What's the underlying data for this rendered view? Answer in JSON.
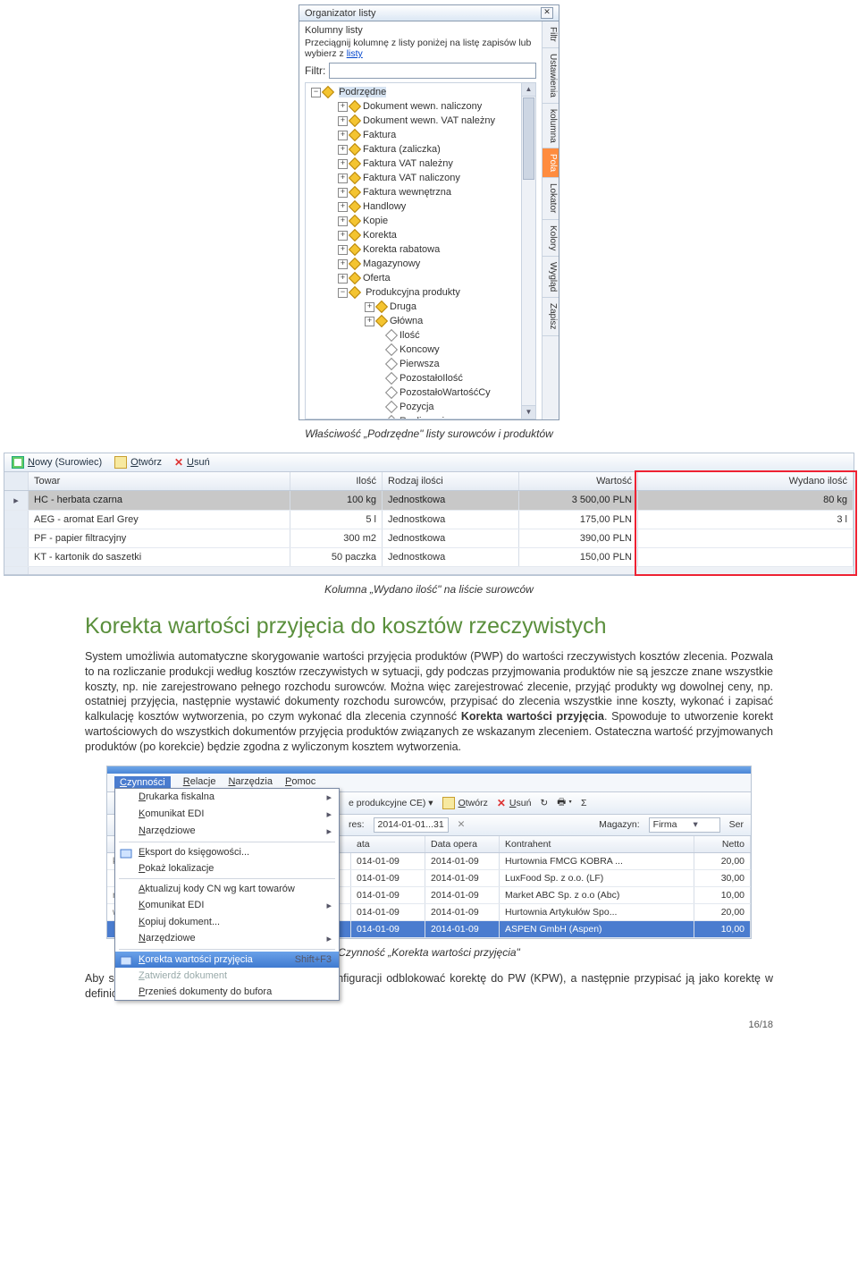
{
  "organizer": {
    "title": "Organizator listy",
    "section_label": "Kolumny listy",
    "hint_pre": "Przeciągnij kolumnę z listy poniżej na listę zapisów lub wybierz z ",
    "hint_link": "listy",
    "filtr_label": "Filtr:",
    "filtr_value": "",
    "tree": {
      "root": "Podrzędne",
      "items": [
        "Dokument wewn. naliczony",
        "Dokument wewn. VAT należny",
        "Faktura",
        "Faktura (zaliczka)",
        "Faktura VAT należny",
        "Faktura VAT naliczony",
        "Faktura wewnętrzna",
        "Handlowy",
        "Kopie",
        "Korekta",
        "Korekta rabatowa",
        "Magazynowy",
        "Oferta"
      ],
      "prod_root": "Produkcyjna produkty",
      "prod_items": [
        "Druga",
        "Główna",
        "Ilość",
        "Koncowy",
        "Pierwsza",
        "PozostałoIlość",
        "PozostałoWartośćCy",
        "Pozycja",
        "Rozliczanie"
      ]
    },
    "side_tabs": [
      "Filtr",
      "Ustawienia",
      "kolumna",
      "Pola",
      "Lokator",
      "Kolory",
      "Wygląd",
      "Zapisz"
    ],
    "side_active": 3
  },
  "caption1": "Właściwość „Podrzędne\" listy surowców i produktów",
  "grid": {
    "buttons": {
      "new": "Nowy (Surowiec)",
      "open": "Otwórz",
      "del": "Usuń"
    },
    "cols": [
      "Towar",
      "Ilość",
      "Rodzaj ilości",
      "Wartość",
      "Wydano ilość"
    ],
    "rows": [
      {
        "towar": "HC - herbata czarna",
        "il": "100 kg",
        "rodz": "Jednostkowa",
        "wart": "3 500,00 PLN",
        "wyd": "80 kg",
        "sel": true
      },
      {
        "towar": "AEG - aromat Earl Grey",
        "il": "5 l",
        "rodz": "Jednostkowa",
        "wart": "175,00 PLN",
        "wyd": "3 l"
      },
      {
        "towar": "PF - papier filtracyjny",
        "il": "300 m2",
        "rodz": "Jednostkowa",
        "wart": "390,00 PLN",
        "wyd": ""
      },
      {
        "towar": "KT - kartonik do saszetki",
        "il": "50 paczka",
        "rodz": "Jednostkowa",
        "wart": "150,00 PLN",
        "wyd": ""
      }
    ]
  },
  "caption2": "Kolumna „Wydano ilość\" na liście surowców",
  "section_title": "Korekta wartości przyjęcia do kosztów rzeczywistych",
  "para1": "System umożliwia automatyczne skorygowanie wartości przyjęcia produktów (PWP) do wartości rzeczywistych kosztów zlecenia. Pozwala to na rozliczanie produkcji według kosztów rzeczywistych w sytuacji, gdy podczas przyjmowania produktów nie są jeszcze znane wszystkie koszty, np. nie zarejestrowano pełnego rozchodu surowców. Można więc zarejestrować zlecenie, przyjąć produkty wg dowolnej ceny, np. ostatniej przyjęcia, następnie wystawić dokumenty rozchodu surowców, przypisać do zlecenia wszystkie inne koszty, wykonać i zapisać kalkulację kosztów wytworzenia, po czym wykonać dla zlecenia czynność ",
  "para1_bold": "Korekta wartości przyjęcia",
  "para1_post": ". Spowoduje to utworzenie korekt wartościowych do wszystkich dokumentów przyjęcia produktów związanych ze wskazanym zleceniem. Ostateczna wartość przyjmowanych produktów (po korekcie) będzie zgodna z wyliczonym kosztem wytworzenia.",
  "menu_shot": {
    "menubar": [
      "Czynności",
      "Relacje",
      "Narzędzia",
      "Pomoc"
    ],
    "menu_open_idx": 0,
    "items": [
      {
        "label": "Drukarka fiskalna",
        "sub": true
      },
      {
        "label": "Komunikat EDI",
        "sub": true
      },
      {
        "label": "Narzędziowe",
        "sub": true
      },
      {
        "sep": true
      },
      {
        "label": "Eksport do księgowości...",
        "icon": true
      },
      {
        "label": "Pokaż lokalizacje"
      },
      {
        "sep": true
      },
      {
        "label": "Aktualizuj kody CN wg kart towarów"
      },
      {
        "label": "Komunikat EDI",
        "sub": true
      },
      {
        "label": "Kopiuj dokument..."
      },
      {
        "label": "Narzędziowe",
        "sub": true
      },
      {
        "sep": true
      },
      {
        "label": "Korekta wartości przyjęcia",
        "shortcut": "Shift+F3",
        "sel": true,
        "icon": true
      },
      {
        "label": "Zatwierdź dokument",
        "dis": true
      },
      {
        "label": "Przenieś dokumenty do bufora"
      }
    ],
    "toolbar": {
      "left_label": "e produkcyjne CE) ▾",
      "open": "Otwórz",
      "del": "Usuń",
      "okres_label": "res:",
      "okres_val": "2014-01-01...31",
      "mag_label": "Magazyn:",
      "mag_val": "Firma",
      "ser": "Ser"
    },
    "cols": [
      "ata",
      "Data opera",
      "Kontrahent",
      "Netto"
    ],
    "rows": [
      {
        "d1": "014-01-09",
        "d2": "2014-01-09",
        "k": "Hurtownia FMCG KOBRA   ...",
        "n": "20,00"
      },
      {
        "d1": "014-01-09",
        "d2": "2014-01-09",
        "k": "LuxFood Sp. z o.o. (LF)",
        "n": "30,00"
      },
      {
        "d1": "014-01-09",
        "d2": "2014-01-09",
        "k": "Market ABC Sp. z o.o (Abc)",
        "n": "10,00"
      },
      {
        "d1": "014-01-09",
        "d2": "2014-01-09",
        "k": "Hurtownia Artykułów Spo...",
        "n": "20,00"
      },
      {
        "d1": "014-01-09",
        "d2": "2014-01-09",
        "k": "ASPEN GmbH (Aspen)",
        "n": "10,00",
        "sel": true
      }
    ],
    "leftcol_chars": [
      "k",
      "",
      "ra",
      "w",
      ""
    ]
  },
  "caption3": "Czynność „Korekta wartości przyjęcia\"",
  "para2": "Aby skorzystać z tej funkcjonalności, należy w konfiguracji odblokować korektę do PW (KPW), a następnie przypisać ją jako korektę w definicji PWP.",
  "page_num": "16/18"
}
